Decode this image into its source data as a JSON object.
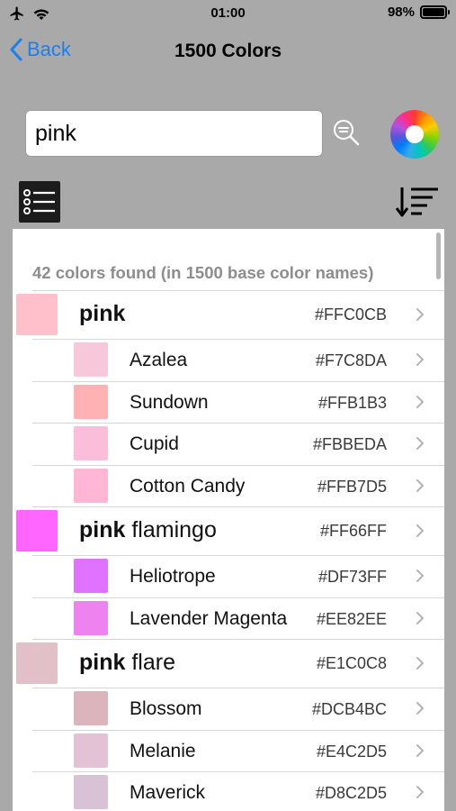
{
  "status": {
    "time": "01:00",
    "battery": "98%",
    "battery_level": 0.98
  },
  "nav": {
    "back_label": "Back",
    "title": "1500 Colors"
  },
  "search": {
    "value": "pink"
  },
  "results": {
    "found_text": "42 colors found (in 1500 base color names)"
  },
  "rows": [
    {
      "kind": "main",
      "name_bold": "pink",
      "name_rest": "",
      "hex": "#FFC0CB",
      "color": "#FFC0CB"
    },
    {
      "kind": "sub",
      "name": "Azalea",
      "hex": "#F7C8DA",
      "color": "#F7C8DA"
    },
    {
      "kind": "sub",
      "name": "Sundown",
      "hex": "#FFB1B3",
      "color": "#FFB1B3"
    },
    {
      "kind": "sub",
      "name": "Cupid",
      "hex": "#FBBEDA",
      "color": "#FBBEDA"
    },
    {
      "kind": "sub",
      "name": "Cotton Candy",
      "hex": "#FFB7D5",
      "color": "#FFB7D5"
    },
    {
      "kind": "main",
      "name_bold": "pink",
      "name_rest": " flamingo",
      "hex": "#FF66FF",
      "color": "#FF66FF"
    },
    {
      "kind": "sub",
      "name": "Heliotrope",
      "hex": "#DF73FF",
      "color": "#DF73FF"
    },
    {
      "kind": "sub",
      "name": "Lavender Magenta",
      "hex": "#EE82EE",
      "color": "#EE82EE"
    },
    {
      "kind": "main",
      "name_bold": "pink",
      "name_rest": " flare",
      "hex": "#E1C0C8",
      "color": "#E1C0C8"
    },
    {
      "kind": "sub",
      "name": "Blossom",
      "hex": "#DCB4BC",
      "color": "#DCB4BC"
    },
    {
      "kind": "sub",
      "name": "Melanie",
      "hex": "#E4C2D5",
      "color": "#E4C2D5"
    },
    {
      "kind": "sub",
      "name": "Maverick",
      "hex": "#D8C2D5",
      "color": "#D8C2D5"
    }
  ],
  "icons": {
    "airplane": "airplane-icon",
    "wifi": "wifi-icon",
    "battery": "battery-icon",
    "back": "chevron-left-icon",
    "search": "search-icon",
    "color_wheel": "color-wheel-icon",
    "list": "list-icon",
    "sort": "sort-icon",
    "row_chevron": "chevron-right-icon"
  },
  "colors": {
    "accent": "#1A7FF0",
    "background": "#A9A9A9"
  }
}
